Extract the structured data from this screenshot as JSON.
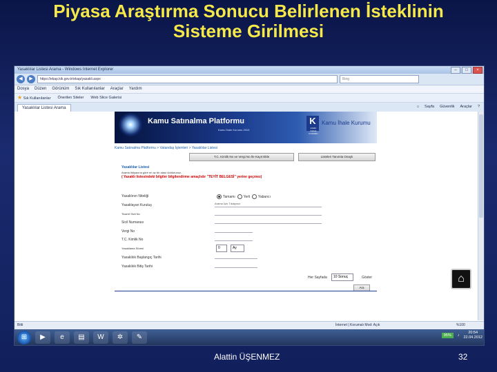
{
  "slide": {
    "title": "Piyasa Araştırma Sonucu Belirlenen İsteklinin Sisteme Girilmesi",
    "author": "Alattin ÜŞENMEZ",
    "page_number": "32"
  },
  "browser": {
    "window_title": "Yasaklılar Listesi Arama - Windows Internet Explorer",
    "address": "https://ekap.kik.gov.tr/ekap/yasakli.aspx",
    "search_placeholder": "Bing",
    "menu": [
      "Dosya",
      "Düzen",
      "Görünüm",
      "Sık Kullanılanlar",
      "Araçlar",
      "Yardım"
    ],
    "favorites": [
      "Sık Kullanılanlar",
      "Önerilen Siteler",
      "Web Slice Galerisi"
    ],
    "tab_label": "Yasaklılar Listesi Arama",
    "commands": [
      "Sayfa",
      "Güvenlik",
      "Araçlar"
    ],
    "status_left": "Bitti",
    "status_right": "İnternet | Korumalı Mod: Açık",
    "zoom": "%100"
  },
  "page": {
    "brand": "Kamu Satınalma Platformu",
    "brand_sub": "Kamu İhale Kurumu 2010",
    "k_logo": "K",
    "k_logo_sub": "KAMU İHALE KURUMU",
    "brand_right": "Kamu İhale Kurumu",
    "breadcrumb": "Kamu Satınalma Platformu > Vatandaş İşlemleri > Yasaklılar Listesi",
    "btn_tc": "T.C. Kimlik No ve Vergi No İle Kayıt Ekle",
    "btn_list": "Listeleri Tanımla Onaylı",
    "form_title": "Yasaklılar Listesi",
    "note": "Arama ihtiyacına göre en az bir alanı doldurunuz.",
    "warning": "( Yasaklı listesindeki bilgiler bilgilendirme amaçlıdır \"TEYİT BELGESİ\" yerine geçmez)",
    "label_type": "Yasaklının Niteliği",
    "radio_options": [
      "Tamamı",
      "Yerli",
      "Yabancı"
    ],
    "label_agency": "Yasaklayan Kuruluş",
    "agency_placeholder": "Arama İçin Tıklayınız",
    "label_registry": "Ticaret Sicil No",
    "label_company": "Sicil Numarası",
    "label_tax": "Vergi No",
    "label_tc": "T.C. Kimlik No",
    "label_period": "Yasaklama Süresi",
    "period_value": "0",
    "period_unit": "Ay",
    "label_start": "Yasaklılık Başlangıç Tarihi",
    "label_end": "Yasaklılık Bitiş Tarihi",
    "per_page_label": "Her Sayfada",
    "per_page_value": "10 Sonuç",
    "per_page_suffix": "Göster",
    "search_button": "Ara"
  },
  "taskbar": {
    "battery": "95%",
    "time": "20:54",
    "date": "22.04.2012"
  }
}
